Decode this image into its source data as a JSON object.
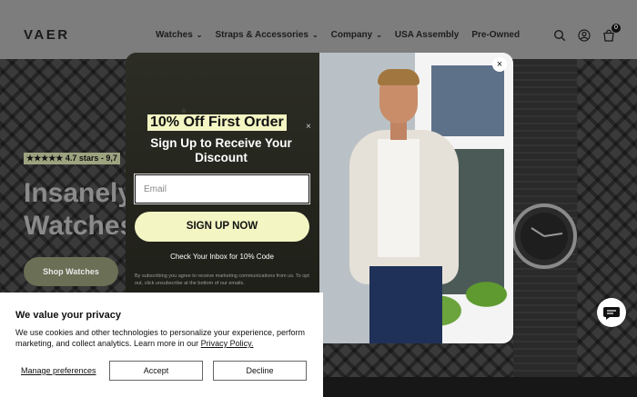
{
  "header": {
    "logo": "VAER",
    "nav": [
      {
        "label": "Watches",
        "dropdown": true
      },
      {
        "label": "Straps & Accessories",
        "dropdown": true
      },
      {
        "label": "Company",
        "dropdown": true
      },
      {
        "label": "USA Assembly",
        "dropdown": false
      },
      {
        "label": "Pre-Owned",
        "dropdown": false
      }
    ],
    "chevron": "⌄",
    "cart_count": "0",
    "icons": [
      "search-icon",
      "account-icon",
      "cart-icon"
    ]
  },
  "hero": {
    "rating_text": "★★★★★ 4.7 stars - 9,7",
    "title_line1": "Insanely",
    "title_line2": "Watches",
    "cta": "Shop Watches"
  },
  "popup": {
    "offer": "10% Off First Order",
    "headline": "Sign Up to Receive Your Discount",
    "email_placeholder": "Email",
    "button": "SIGN UP NOW",
    "inbox_note": "Check Your Inbox for 10% Code",
    "fine_print": "By subscribing you agree to receive marketing communications from us. To opt out, click unsubscribe at the bottom of our emails.",
    "close": "×",
    "corner_glyph": "×"
  },
  "cookie": {
    "title": "We value your privacy",
    "text": "We use cookies and other technologies to personalize your experience, perform marketing, and collect analytics. Learn more in our ",
    "link": "Privacy Policy.",
    "manage": "Manage preferences",
    "accept": "Accept",
    "decline": "Decline"
  },
  "colors": {
    "accent_yellow": "#f3f5c3",
    "hero_button": "#6a6f55"
  }
}
